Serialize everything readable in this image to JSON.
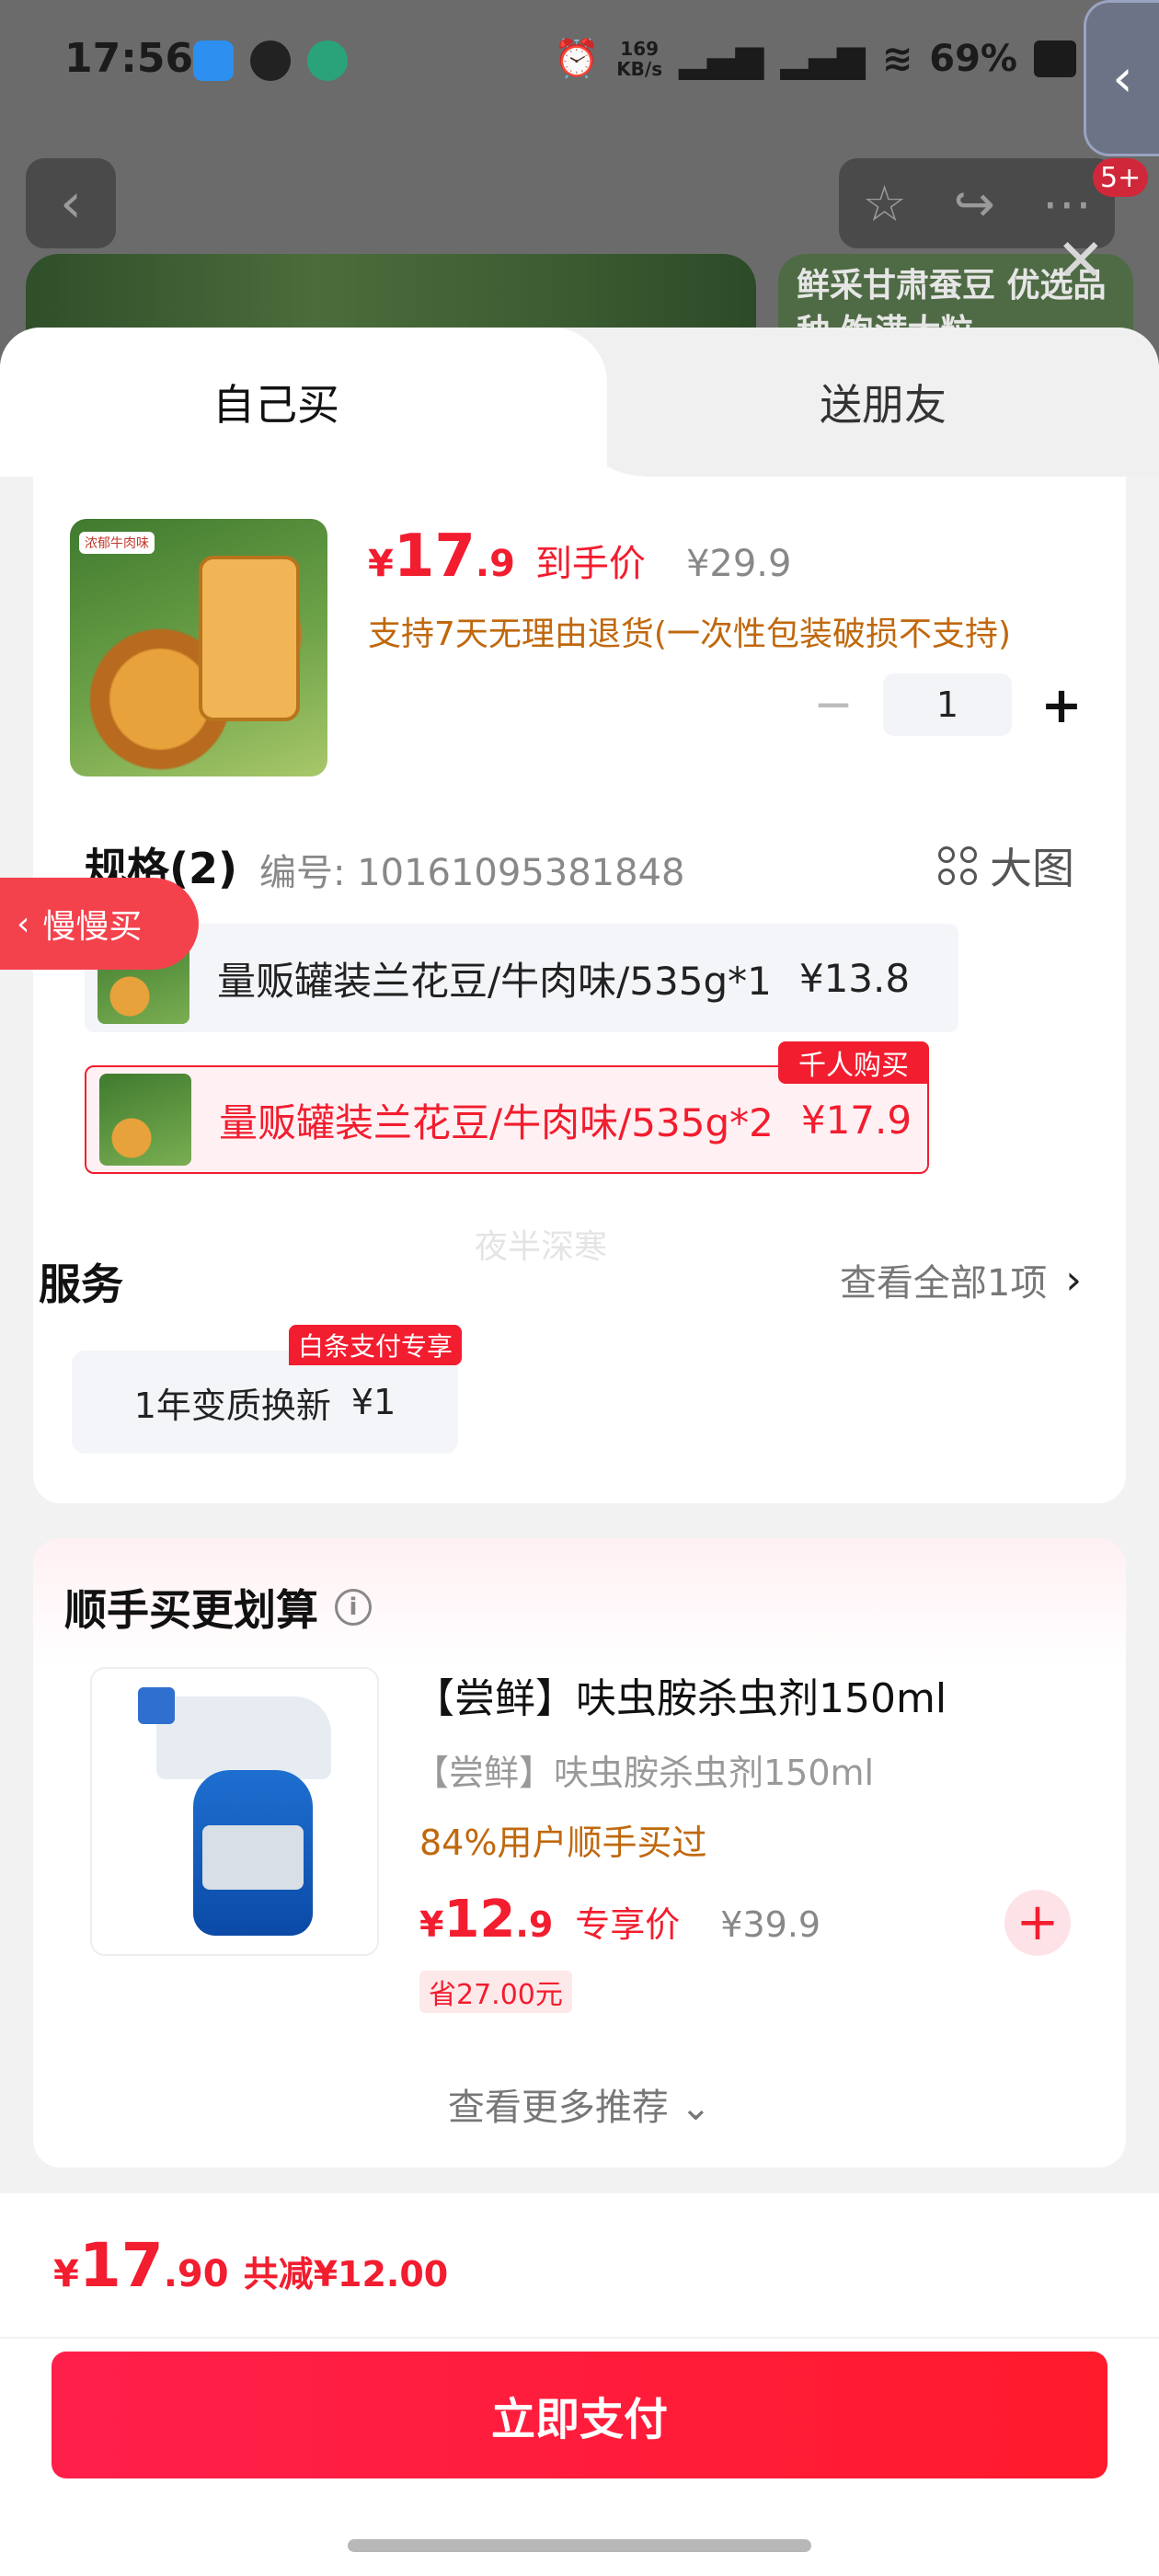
{
  "status_bar": {
    "time": "17:56",
    "speed_value": "169",
    "speed_unit": "KB/s",
    "battery": "69%"
  },
  "background": {
    "side_card_text": "鲜采甘肃蚕豆 优选品种 饱满大粒",
    "badge": "5+"
  },
  "tabs": {
    "self": "自己买",
    "friend": "送朋友"
  },
  "product": {
    "price_yen": "¥",
    "price_int": "17",
    "price_dec": ".9",
    "price_label": "到手价",
    "orig_price": "¥29.9",
    "return_note": "支持7天无理由退货(一次性包装破损不支持)",
    "quantity": "1",
    "img_tag": "浓郁牛肉味"
  },
  "spec": {
    "title": "规格(2)",
    "code": "编号: 10161095381848",
    "big_image": "大图",
    "options": [
      {
        "name": "量贩罐装兰花豆/牛肉味/535g*1",
        "price": "¥13.8"
      },
      {
        "name": "量贩罐装兰花豆/牛肉味/535g*2",
        "price": "¥17.9"
      }
    ],
    "hot_badge": "千人购买"
  },
  "slow_buy": "慢慢买",
  "watermark": "夜半深寒",
  "service": {
    "title": "服务",
    "view_all": "查看全部1项",
    "item": "1年变质换新",
    "item_price": "¥1",
    "badge": "白条支付专享"
  },
  "addon": {
    "title": "顺手买更划算",
    "name": "【尝鲜】呋虫胺杀虫剂150ml",
    "sub": "【尝鲜】呋虫胺杀虫剂150ml",
    "buyers": "84%用户顺手买过",
    "price_yen": "¥",
    "price_int": "12",
    "price_dec": ".9",
    "price_label": "专享价",
    "orig_price": "¥39.9",
    "save": "省27.00元",
    "more": "查看更多推荐 ⌄"
  },
  "footer": {
    "total_yen": "¥",
    "total_int": "17",
    "total_dec": ".90",
    "saving": "共减¥12.00",
    "pay_button": "立即支付"
  },
  "colors": {
    "accent": "#f21d2f",
    "orange_text": "#c0680d",
    "pay_gradient_start": "#ff1f4b"
  },
  "icons": [
    "back-icon",
    "star-icon",
    "share-icon",
    "more-icon",
    "close-icon",
    "grid-icon",
    "chevron-right-icon",
    "info-icon",
    "plus-icon",
    "minus-icon"
  ]
}
